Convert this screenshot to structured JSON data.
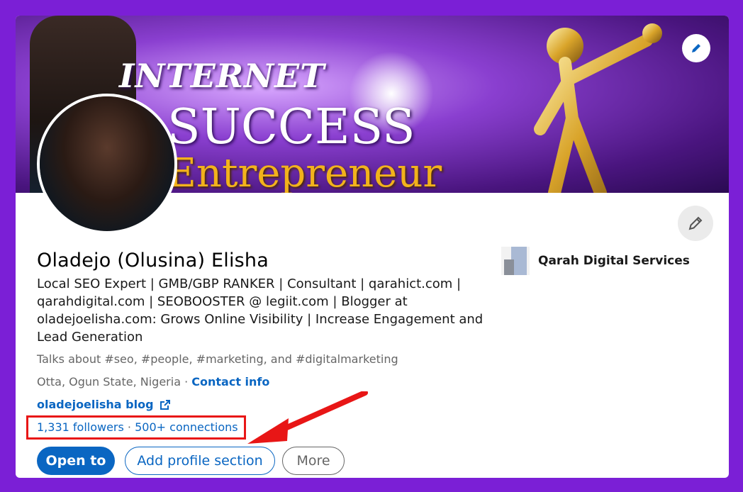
{
  "profile": {
    "name": "Oladejo (Olusina) Elisha",
    "headline": "Local SEO Expert | GMB/GBP RANKER | Consultant | qarahict.com | qarahdigital.com | SEOBOOSTER @ legiit.com | Blogger at oladejoelisha.com: Grows Online Visibility | Increase Engagement and Lead Generation",
    "talks_about": "Talks about #seo, #people, #marketing, and #digitalmarketing",
    "location": "Otta, Ogun State, Nigeria",
    "separator": " · ",
    "contact_info": "Contact info",
    "website": "oladejoelisha blog",
    "followers": "1,331 followers",
    "connections": "500+ connections"
  },
  "banner": {
    "line1": "INTERNET",
    "line2": "SUCCESS",
    "line3": "Entrepreneur"
  },
  "company": {
    "name": "Qarah Digital Services"
  },
  "actions": {
    "open_to": "Open to",
    "add_section": "Add profile section",
    "more": "More"
  },
  "colors": {
    "frame": "#7b1fd6",
    "link": "#0a66c2",
    "highlight": "#e81616"
  },
  "icons": [
    "pencil-icon",
    "external-link-icon",
    "arrow-annotation"
  ]
}
